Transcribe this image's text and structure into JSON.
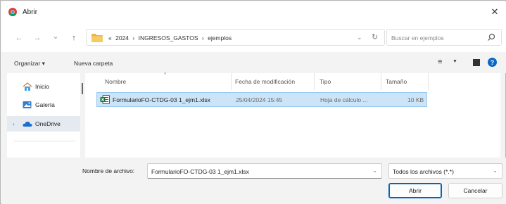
{
  "window": {
    "title": "Abrir",
    "close_glyph": "✕"
  },
  "nav": {
    "back_glyph": "←",
    "forward_glyph": "→",
    "recent_glyph": "⌄",
    "up_glyph": "↑",
    "breadcrumb": [
      "«",
      "2024",
      "›",
      "INGRESOS_GASTOS",
      "›",
      "ejemplos"
    ],
    "refresh_glyph": "↻",
    "dropdown_glyph": "⌄",
    "search_placeholder": "Buscar en ejemplos"
  },
  "toolbar": {
    "organize_label": "Organizar ▾",
    "new_folder_label": "Nueva carpeta",
    "view_glyph": "≡",
    "view_chev": "▼",
    "help_glyph": "?"
  },
  "sidebar": {
    "items": [
      {
        "label": "Inicio",
        "icon": "home-icon"
      },
      {
        "label": "Galería",
        "icon": "gallery-icon"
      },
      {
        "label": "OneDrive",
        "icon": "cloud-icon",
        "expand": "›"
      }
    ]
  },
  "columns": {
    "name": "Nombre",
    "modified": "Fecha de modificación",
    "type": "Tipo",
    "size": "Tamaño",
    "sort_glyph": "^"
  },
  "files": [
    {
      "name": "FormularioFO-CTDG-03 1_ejm1.xlsx",
      "modified": "25/04/2024 15:45",
      "type": "Hoja de cálculo ...",
      "size": "10 KB"
    }
  ],
  "footer": {
    "filename_label": "Nombre de archivo:",
    "filename_value": "FormularioFO-CTDG-03 1_ejm1.xlsx",
    "filetype_value": "Todos los archivos (*.*)",
    "chev_glyph": "⌄",
    "open_label": "Abrir",
    "cancel_label": "Cancelar"
  },
  "colors": {
    "accent": "#0067c0",
    "selection": "#cce4f7",
    "excel": "#1d6f42",
    "folder": "#e8b84a"
  }
}
